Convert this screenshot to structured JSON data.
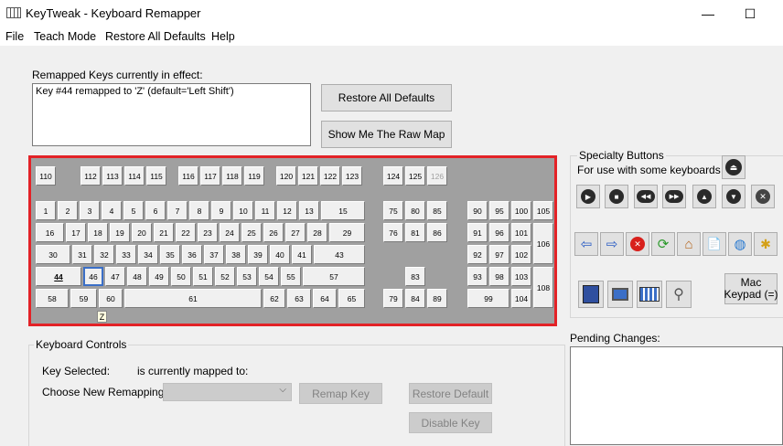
{
  "window": {
    "title": "KeyTweak -  Keyboard Remapper",
    "minimize": "—",
    "maximize": "☐"
  },
  "menu": [
    "File",
    "Teach Mode",
    "Restore All Defaults",
    "Help"
  ],
  "remapped": {
    "label": "Remapped Keys currently in effect:",
    "text": "Key #44 remapped to 'Z' (default='Left Shift')"
  },
  "buttons": {
    "restore_all": "Restore All Defaults",
    "raw_map": "Show Me The Raw Map"
  },
  "keyboard": {
    "keys": [
      {
        "label": "110"
      },
      {
        "label": "112"
      },
      {
        "label": "113"
      },
      {
        "label": "114"
      },
      {
        "label": "115"
      },
      {
        "label": "116"
      },
      {
        "label": "117"
      },
      {
        "label": "118"
      },
      {
        "label": "119"
      },
      {
        "label": "120"
      },
      {
        "label": "121"
      },
      {
        "label": "122"
      },
      {
        "label": "123"
      },
      {
        "label": "124"
      },
      {
        "label": "125"
      },
      {
        "label": "126",
        "dim": true
      },
      {
        "label": "1"
      },
      {
        "label": "2"
      },
      {
        "label": "3"
      },
      {
        "label": "4"
      },
      {
        "label": "5"
      },
      {
        "label": "6"
      },
      {
        "label": "7"
      },
      {
        "label": "8"
      },
      {
        "label": "9"
      },
      {
        "label": "10"
      },
      {
        "label": "11"
      },
      {
        "label": "12"
      },
      {
        "label": "13"
      },
      {
        "label": "15"
      },
      {
        "label": "75"
      },
      {
        "label": "80"
      },
      {
        "label": "85"
      },
      {
        "label": "90"
      },
      {
        "label": "95"
      },
      {
        "label": "100"
      },
      {
        "label": "105"
      },
      {
        "label": "16"
      },
      {
        "label": "17"
      },
      {
        "label": "18"
      },
      {
        "label": "19"
      },
      {
        "label": "20"
      },
      {
        "label": "21"
      },
      {
        "label": "22"
      },
      {
        "label": "23"
      },
      {
        "label": "24"
      },
      {
        "label": "25"
      },
      {
        "label": "26"
      },
      {
        "label": "27"
      },
      {
        "label": "28"
      },
      {
        "label": "29"
      },
      {
        "label": "76"
      },
      {
        "label": "81"
      },
      {
        "label": "86"
      },
      {
        "label": "91"
      },
      {
        "label": "96"
      },
      {
        "label": "101"
      },
      {
        "label": "106"
      },
      {
        "label": "30"
      },
      {
        "label": "31"
      },
      {
        "label": "32"
      },
      {
        "label": "33"
      },
      {
        "label": "34"
      },
      {
        "label": "35"
      },
      {
        "label": "36"
      },
      {
        "label": "37"
      },
      {
        "label": "38"
      },
      {
        "label": "39"
      },
      {
        "label": "40"
      },
      {
        "label": "41"
      },
      {
        "label": "43"
      },
      {
        "label": "92"
      },
      {
        "label": "97"
      },
      {
        "label": "102"
      },
      {
        "label": "44",
        "mapped": true
      },
      {
        "label": "46",
        "selected": true
      },
      {
        "label": "47"
      },
      {
        "label": "48"
      },
      {
        "label": "49"
      },
      {
        "label": "50"
      },
      {
        "label": "51"
      },
      {
        "label": "52"
      },
      {
        "label": "53"
      },
      {
        "label": "54"
      },
      {
        "label": "55"
      },
      {
        "label": "57"
      },
      {
        "label": "83"
      },
      {
        "label": "93"
      },
      {
        "label": "98"
      },
      {
        "label": "103"
      },
      {
        "label": "108"
      },
      {
        "label": "58"
      },
      {
        "label": "59"
      },
      {
        "label": "60"
      },
      {
        "label": "61"
      },
      {
        "label": "62"
      },
      {
        "label": "63"
      },
      {
        "label": "64"
      },
      {
        "label": "65"
      },
      {
        "label": "79"
      },
      {
        "label": "84"
      },
      {
        "label": "89"
      },
      {
        "label": "99"
      },
      {
        "label": "104"
      }
    ],
    "mapped_indicator": "Z"
  },
  "specialty": {
    "title": "Specialty Buttons",
    "subtitle": "For use with some keyboards",
    "icons": [
      "eject-icon",
      "play-icon",
      "stop-icon",
      "rewind-icon",
      "fast-forward-icon",
      "volume-up-icon",
      "volume-down-icon",
      "mute-icon",
      "back-arrow-icon",
      "forward-arrow-icon",
      "stop-browser-icon",
      "refresh-icon",
      "home-icon",
      "search-page-icon",
      "web-globe-icon",
      "favorites-folder-icon",
      "media-player-icon",
      "my-computer-icon",
      "calculator-icon",
      "magnifier-icon"
    ],
    "mac_keypad": "Mac\nKeypad (=)"
  },
  "controls": {
    "title": "Keyboard Controls",
    "key_selected": "Key Selected:",
    "mapped_to": "is currently mapped to:",
    "choose_label": "Choose New Remapping",
    "remap_btn": "Remap Key",
    "restore_default_btn": "Restore Default",
    "disable_btn": "Disable Key"
  },
  "pending": {
    "label": "Pending Changes:"
  },
  "colors": {
    "highlight": "#e32227",
    "keyboard_bg": "#a0a0a0",
    "selected": "#3b6fc7"
  }
}
